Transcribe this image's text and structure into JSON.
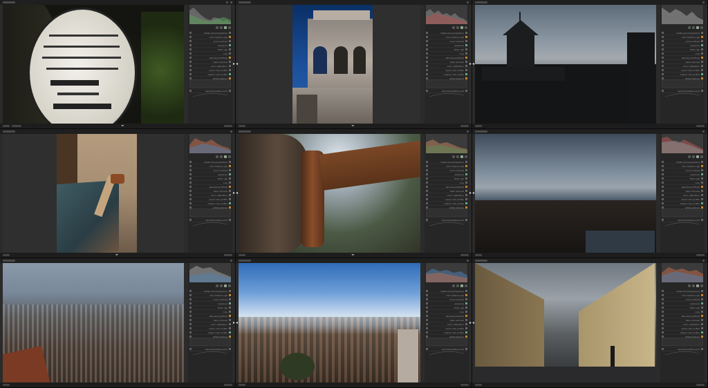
{
  "app": {
    "window_title": "darktable"
  },
  "panel_modules": [
    "rotate and perspective",
    "color balance rgb",
    "local contrast",
    "exposure",
    "filmic rgb",
    "crop",
    "denoise (profiled)",
    "haze removal",
    "color calibration",
    "input color profile",
    "output color profile",
    "white balance",
    "highlight reconstruction",
    "demosaic",
    "raw black/white point"
  ],
  "cells": [
    {
      "id": "1",
      "label": "gravestone-photo"
    },
    {
      "id": "2",
      "label": "ruined-tower-photo"
    },
    {
      "id": "3",
      "label": "church-silhouette-photo"
    },
    {
      "id": "4",
      "label": "wooden-crate-photo"
    },
    {
      "id": "5",
      "label": "rusty-hinge-photo"
    },
    {
      "id": "6",
      "label": "cloudy-city-skyline-photo"
    },
    {
      "id": "7",
      "label": "foggy-city-aerial-photo"
    },
    {
      "id": "8",
      "label": "city-panorama-blue-sky-photo"
    },
    {
      "id": "9",
      "label": "street-wide-angle-photo"
    }
  ],
  "colors": {
    "background": "#111111",
    "panel": "#262626",
    "accent_orange": "#c8862e",
    "accent_green": "#8fa98f"
  }
}
